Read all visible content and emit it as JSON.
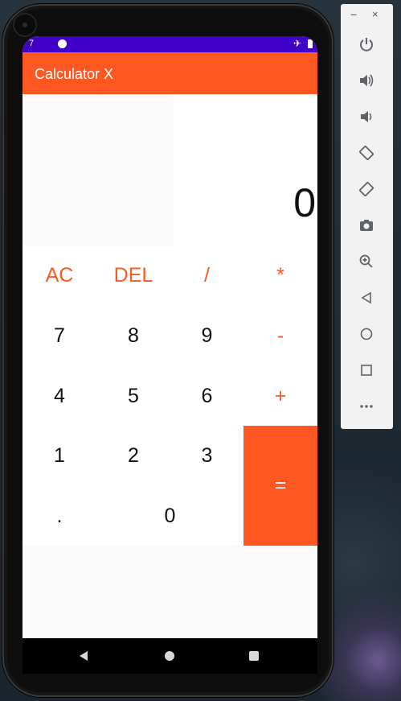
{
  "status_bar": {
    "time": "7"
  },
  "app": {
    "title": "Calculator X"
  },
  "display": {
    "value": "0"
  },
  "keypad": {
    "ac": "AC",
    "del": "DEL",
    "divide": "/",
    "multiply": "*",
    "seven": "7",
    "eight": "8",
    "nine": "9",
    "minus": "-",
    "four": "4",
    "five": "5",
    "six": "6",
    "plus": "+",
    "one": "1",
    "two": "2",
    "three": "3",
    "equals": "=",
    "dot": ".",
    "zero": "0"
  },
  "toolbar": {
    "minimize": "−",
    "close": "×"
  },
  "colors": {
    "accent": "#ff5722",
    "status_bar": "#3f00c8"
  },
  "icons": {
    "toolbar": [
      "power-icon",
      "volume-up-icon",
      "volume-down-icon",
      "rotate-left-icon",
      "rotate-right-icon",
      "camera-icon",
      "zoom-icon",
      "back-icon",
      "home-icon",
      "overview-icon",
      "more-icon"
    ],
    "nav": [
      "back-icon",
      "home-icon",
      "recents-icon"
    ]
  }
}
